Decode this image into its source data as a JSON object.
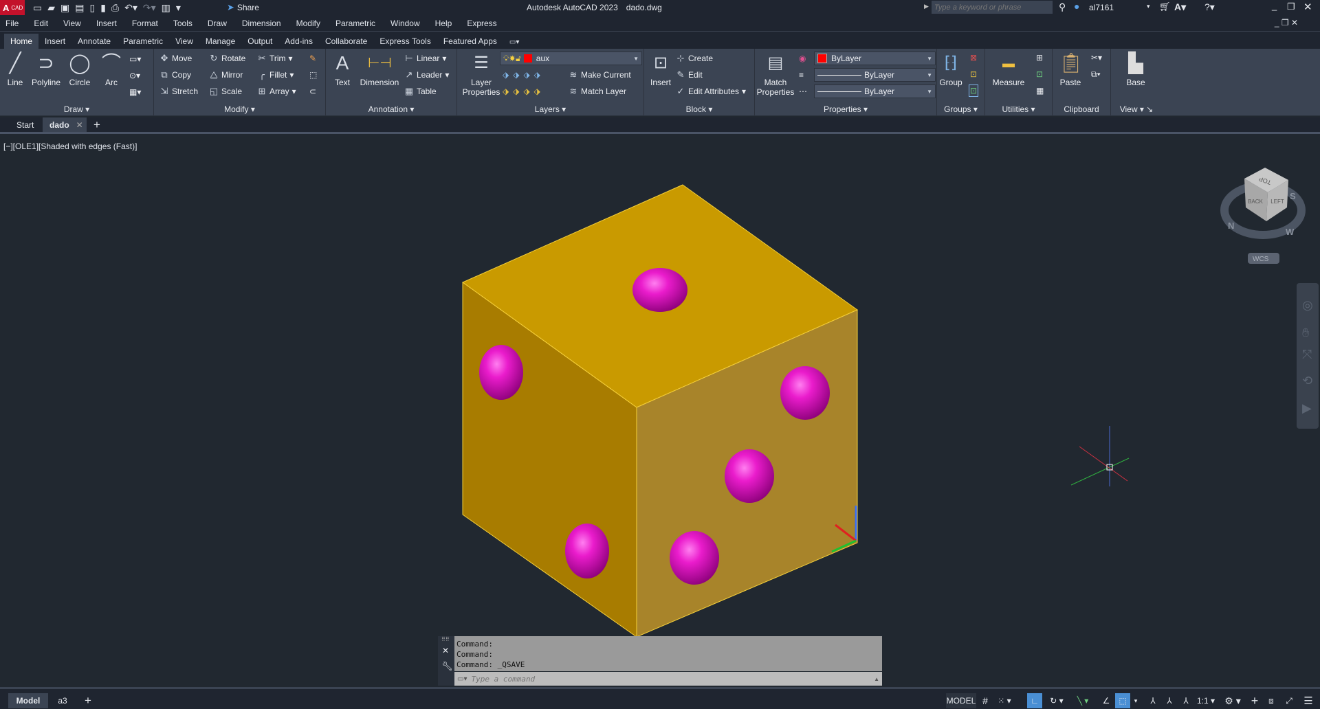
{
  "titlebar": {
    "logo": "A",
    "logo_sub": "CAD",
    "share": "Share",
    "app_title": "Autodesk AutoCAD 2023",
    "file_title": "dado.dwg",
    "search_placeholder": "Type a keyword or phrase",
    "user": "al7161"
  },
  "menu": [
    "File",
    "Edit",
    "View",
    "Insert",
    "Format",
    "Tools",
    "Draw",
    "Dimension",
    "Modify",
    "Parametric",
    "Window",
    "Help",
    "Express"
  ],
  "ribbon_tabs": [
    "Home",
    "Insert",
    "Annotate",
    "Parametric",
    "View",
    "Manage",
    "Output",
    "Add-ins",
    "Collaborate",
    "Express Tools",
    "Featured Apps"
  ],
  "ribbon": {
    "draw": {
      "title": "Draw",
      "line": "Line",
      "polyline": "Polyline",
      "circle": "Circle",
      "arc": "Arc"
    },
    "modify": {
      "title": "Modify",
      "move": "Move",
      "rotate": "Rotate",
      "trim": "Trim",
      "copy": "Copy",
      "mirror": "Mirror",
      "fillet": "Fillet",
      "stretch": "Stretch",
      "scale": "Scale",
      "array": "Array"
    },
    "annotation": {
      "title": "Annotation",
      "text": "Text",
      "dimension": "Dimension",
      "linear": "Linear",
      "leader": "Leader",
      "table": "Table"
    },
    "layers": {
      "title": "Layers",
      "layer_properties_1": "Layer",
      "layer_properties_2": "Properties",
      "current_layer": "aux",
      "make_current": "Make Current",
      "match_layer": "Match Layer"
    },
    "block": {
      "title": "Block",
      "insert": "Insert",
      "create": "Create",
      "edit": "Edit",
      "edit_attributes": "Edit Attributes"
    },
    "properties": {
      "title": "Properties",
      "match_1": "Match",
      "match_2": "Properties",
      "color": "ByLayer",
      "linetype": "ByLayer",
      "lineweight": "ByLayer"
    },
    "groups": {
      "title": "Groups",
      "group": "Group"
    },
    "utilities": {
      "title": "Utilities",
      "measure": "Measure"
    },
    "clipboard": {
      "title": "Clipboard",
      "paste": "Paste"
    },
    "view": {
      "title": "View",
      "base": "Base"
    }
  },
  "file_tabs": {
    "start": "Start",
    "active": "dado"
  },
  "viewport_label": "[−][OLE1][Shaded with edges (Fast)]",
  "viewcube": {
    "top": "TOP",
    "back": "BACK",
    "left": "LEFT",
    "n": "N",
    "s": "S",
    "w": "W",
    "wcs": "WCS"
  },
  "command": {
    "history": [
      "Command:",
      "Command:",
      "Command:  _QSAVE"
    ],
    "placeholder": "Type a command"
  },
  "status": {
    "model_tab": "Model",
    "layout_tab": "a3",
    "model": "MODEL",
    "scale": "1:1"
  },
  "colors": {
    "accent": "#4a8fd4",
    "die": "#c89a00",
    "pip": "#e010c0",
    "layer_color": "#ff0000"
  }
}
